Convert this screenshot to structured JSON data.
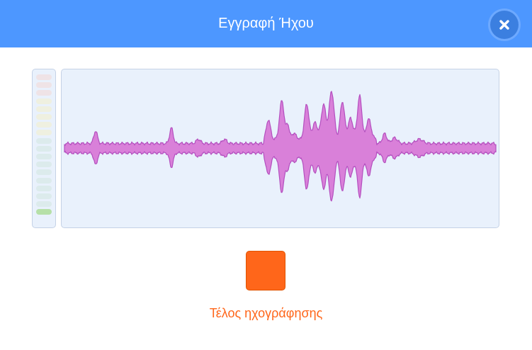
{
  "dialog": {
    "title": "Εγγραφή Ήχου",
    "close_icon": "close-x-icon"
  },
  "colors": {
    "header": "#4d97ff",
    "close_button": "#3b7fe0",
    "panel_bg": "#e9f1fc",
    "panel_border": "#c5d2e6",
    "waveform_fill": "#d980d9",
    "waveform_stroke": "#b44fbf",
    "stop_button": "#ff661a",
    "stop_label": "#ff661a",
    "meter_active": "#b6e0a8"
  },
  "level_meter": {
    "segments": 18,
    "active_segments": 1
  },
  "recording": {
    "stop_label": "Τέλος ηχογράφησης"
  }
}
